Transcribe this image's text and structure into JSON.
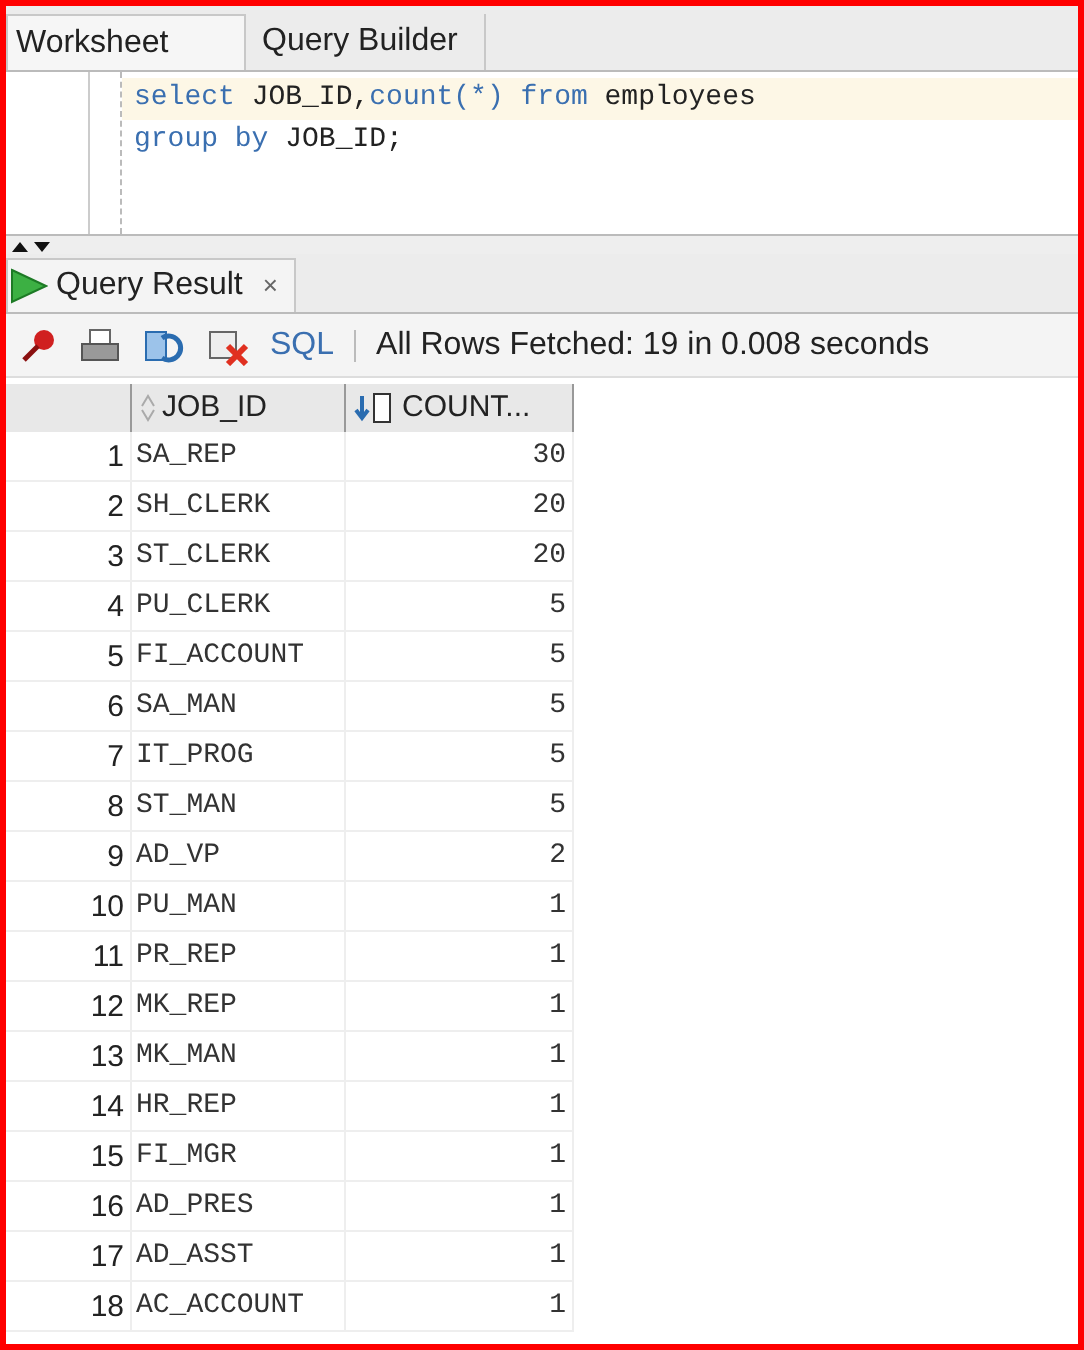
{
  "tabs": [
    {
      "label": "Worksheet",
      "selected": true
    },
    {
      "label": "Query Builder",
      "selected": false
    }
  ],
  "editor": {
    "lines": [
      {
        "current": true,
        "tokens": [
          {
            "kind": "keyword",
            "text": "select"
          },
          {
            "kind": "plain",
            "text": " JOB_ID,"
          },
          {
            "kind": "keyword",
            "text": "count(*)"
          },
          {
            "kind": "keyword",
            "text": " from"
          },
          {
            "kind": "plain",
            "text": " employees"
          }
        ]
      },
      {
        "current": false,
        "tokens": [
          {
            "kind": "keyword",
            "text": "group by"
          },
          {
            "kind": "plain",
            "text": " JOB_ID;"
          }
        ]
      }
    ]
  },
  "result_tab": {
    "label": "Query Result",
    "close": "×"
  },
  "toolbar": {
    "sql_label": "SQL",
    "status": "All Rows Fetched: 19 in 0.008 seconds"
  },
  "table": {
    "columns": [
      "",
      "JOB_ID",
      "COUNT..."
    ],
    "rows": [
      [
        "1",
        "SA_REP",
        "30"
      ],
      [
        "2",
        "SH_CLERK",
        "20"
      ],
      [
        "3",
        "ST_CLERK",
        "20"
      ],
      [
        "4",
        "PU_CLERK",
        "5"
      ],
      [
        "5",
        "FI_ACCOUNT",
        "5"
      ],
      [
        "6",
        "SA_MAN",
        "5"
      ],
      [
        "7",
        "IT_PROG",
        "5"
      ],
      [
        "8",
        "ST_MAN",
        "5"
      ],
      [
        "9",
        "AD_VP",
        "2"
      ],
      [
        "10",
        "PU_MAN",
        "1"
      ],
      [
        "11",
        "PR_REP",
        "1"
      ],
      [
        "12",
        "MK_REP",
        "1"
      ],
      [
        "13",
        "MK_MAN",
        "1"
      ],
      [
        "14",
        "HR_REP",
        "1"
      ],
      [
        "15",
        "FI_MGR",
        "1"
      ],
      [
        "16",
        "AD_PRES",
        "1"
      ],
      [
        "17",
        "AD_ASST",
        "1"
      ],
      [
        "18",
        "AC_ACCOUNT",
        "1"
      ]
    ]
  }
}
